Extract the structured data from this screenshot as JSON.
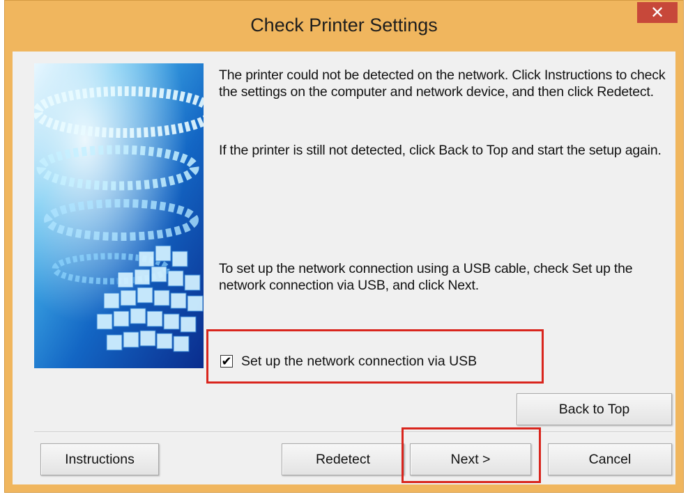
{
  "window": {
    "title": "Check Printer Settings",
    "close_symbol": "✕",
    "accent_color": "#f0b65e",
    "close_color": "#c7483a"
  },
  "message": {
    "paragraph1": "The printer could not be detected on the network. Click Instructions to check the settings on the computer and network device, and then click Redetect.",
    "paragraph2": "If the printer is still not detected, click Back to Top and start the setup again.",
    "paragraph3": "To set up the network connection using a USB cable, check Set up the network connection via USB, and click Next."
  },
  "usb_option": {
    "label": "Set up the network connection via USB",
    "checked": true,
    "check_mark": "✔"
  },
  "buttons": {
    "back_to_top": "Back to Top",
    "instructions": "Instructions",
    "redetect": "Redetect",
    "next": "Next >",
    "cancel": "Cancel"
  },
  "annotation_color": "#d9251d",
  "hero_icon": "printer-cube-spiral-illustration"
}
